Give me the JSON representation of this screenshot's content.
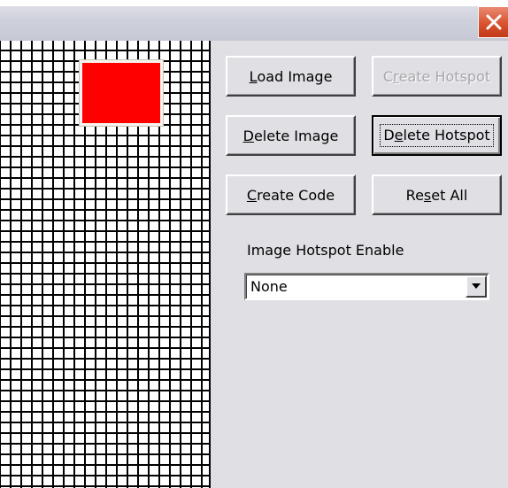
{
  "window": {
    "close_icon": "close-icon"
  },
  "buttons": {
    "load_image": {
      "pre": "",
      "ul": "L",
      "post": "oad Image"
    },
    "create_hotspot": {
      "pre": "C",
      "ul": "r",
      "post": "eate Hotspot"
    },
    "delete_image": {
      "pre": "",
      "ul": "D",
      "post": "elete Image"
    },
    "delete_hotspot": {
      "pre": "D",
      "ul": "e",
      "post": "lete Hotspot"
    },
    "create_code": {
      "pre": "",
      "ul": "C",
      "post": "reate Code"
    },
    "reset_all": {
      "pre": "Re",
      "ul": "s",
      "post": "et All"
    }
  },
  "hotspot_enable": {
    "label": "Image Hotspot Enable",
    "selected": "None"
  },
  "colors": {
    "hotspot_fill": "#fe0000",
    "window_bg": "#e0dfe3",
    "close_button": "#d8532f"
  }
}
